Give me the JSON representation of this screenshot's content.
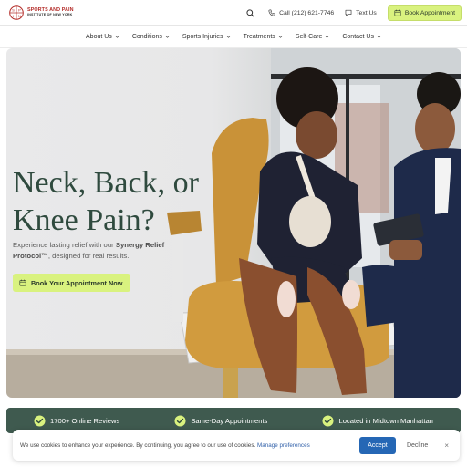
{
  "header": {
    "logo_line1": "SPORTS AND PAIN",
    "logo_line2": "INSTITUTE OF NEW YORK",
    "call_label": "Call (212) 621-7746",
    "text_label": "Text Us",
    "book_label": "Book Appointment"
  },
  "nav": {
    "items": [
      {
        "label": "About Us"
      },
      {
        "label": "Conditions"
      },
      {
        "label": "Sports Injuries"
      },
      {
        "label": "Treatments"
      },
      {
        "label": "Self-Care"
      },
      {
        "label": "Contact Us"
      }
    ]
  },
  "hero": {
    "title_line1": "Neck, Back, or",
    "title_line2": "Knee Pain?",
    "subtitle_before": "Experience lasting relief with our ",
    "subtitle_bold": "Synergy Relief Protocol™",
    "subtitle_after": ", designed for real results.",
    "cta_label": "Book Your Appointment Now"
  },
  "features": [
    {
      "label": "1700+ Online Reviews"
    },
    {
      "label": "Same-Day Appointments"
    },
    {
      "label": "Located in Midtown Manhattan"
    }
  ],
  "cookie": {
    "text": "We use cookies to enhance your experience. By continuing, you agree to our use of cookies.",
    "link": "Manage preferences",
    "accept": "Accept",
    "decline": "Decline",
    "close": "×"
  },
  "colors": {
    "accent_lime": "#d9f27f",
    "brand_green": "#3f5a4f",
    "title_green": "#2f4a3e",
    "logo_red": "#b32a26",
    "accept_blue": "#2567b5"
  },
  "icons": [
    "logo-mark",
    "search-icon",
    "phone-icon",
    "chat-icon",
    "calendar-icon",
    "chevron-down-icon",
    "check-circle-icon"
  ]
}
